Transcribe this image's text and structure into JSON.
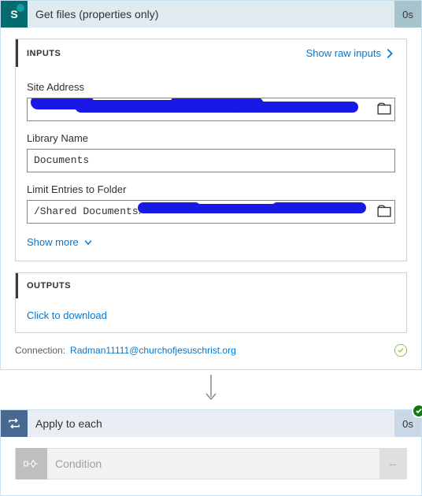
{
  "card1": {
    "title": "Get files (properties only)",
    "duration": "0s",
    "inputs": {
      "header": "INPUTS",
      "raw_link": "Show raw inputs",
      "fields": {
        "site_address": {
          "label": "Site Address",
          "value": ""
        },
        "library_name": {
          "label": "Library Name",
          "value": "Documents"
        },
        "limit_folder": {
          "label": "Limit Entries to Folder",
          "value": "/Shared Documents/"
        }
      },
      "show_more": "Show more"
    },
    "outputs": {
      "header": "OUTPUTS",
      "download": "Click to download"
    },
    "connection": {
      "label": "Connection:",
      "value": "Radman11111@churchofjesuschrist.org"
    }
  },
  "card2": {
    "title": "Apply to each",
    "duration": "0s",
    "nested": {
      "title": "Condition",
      "duration": "--"
    }
  }
}
